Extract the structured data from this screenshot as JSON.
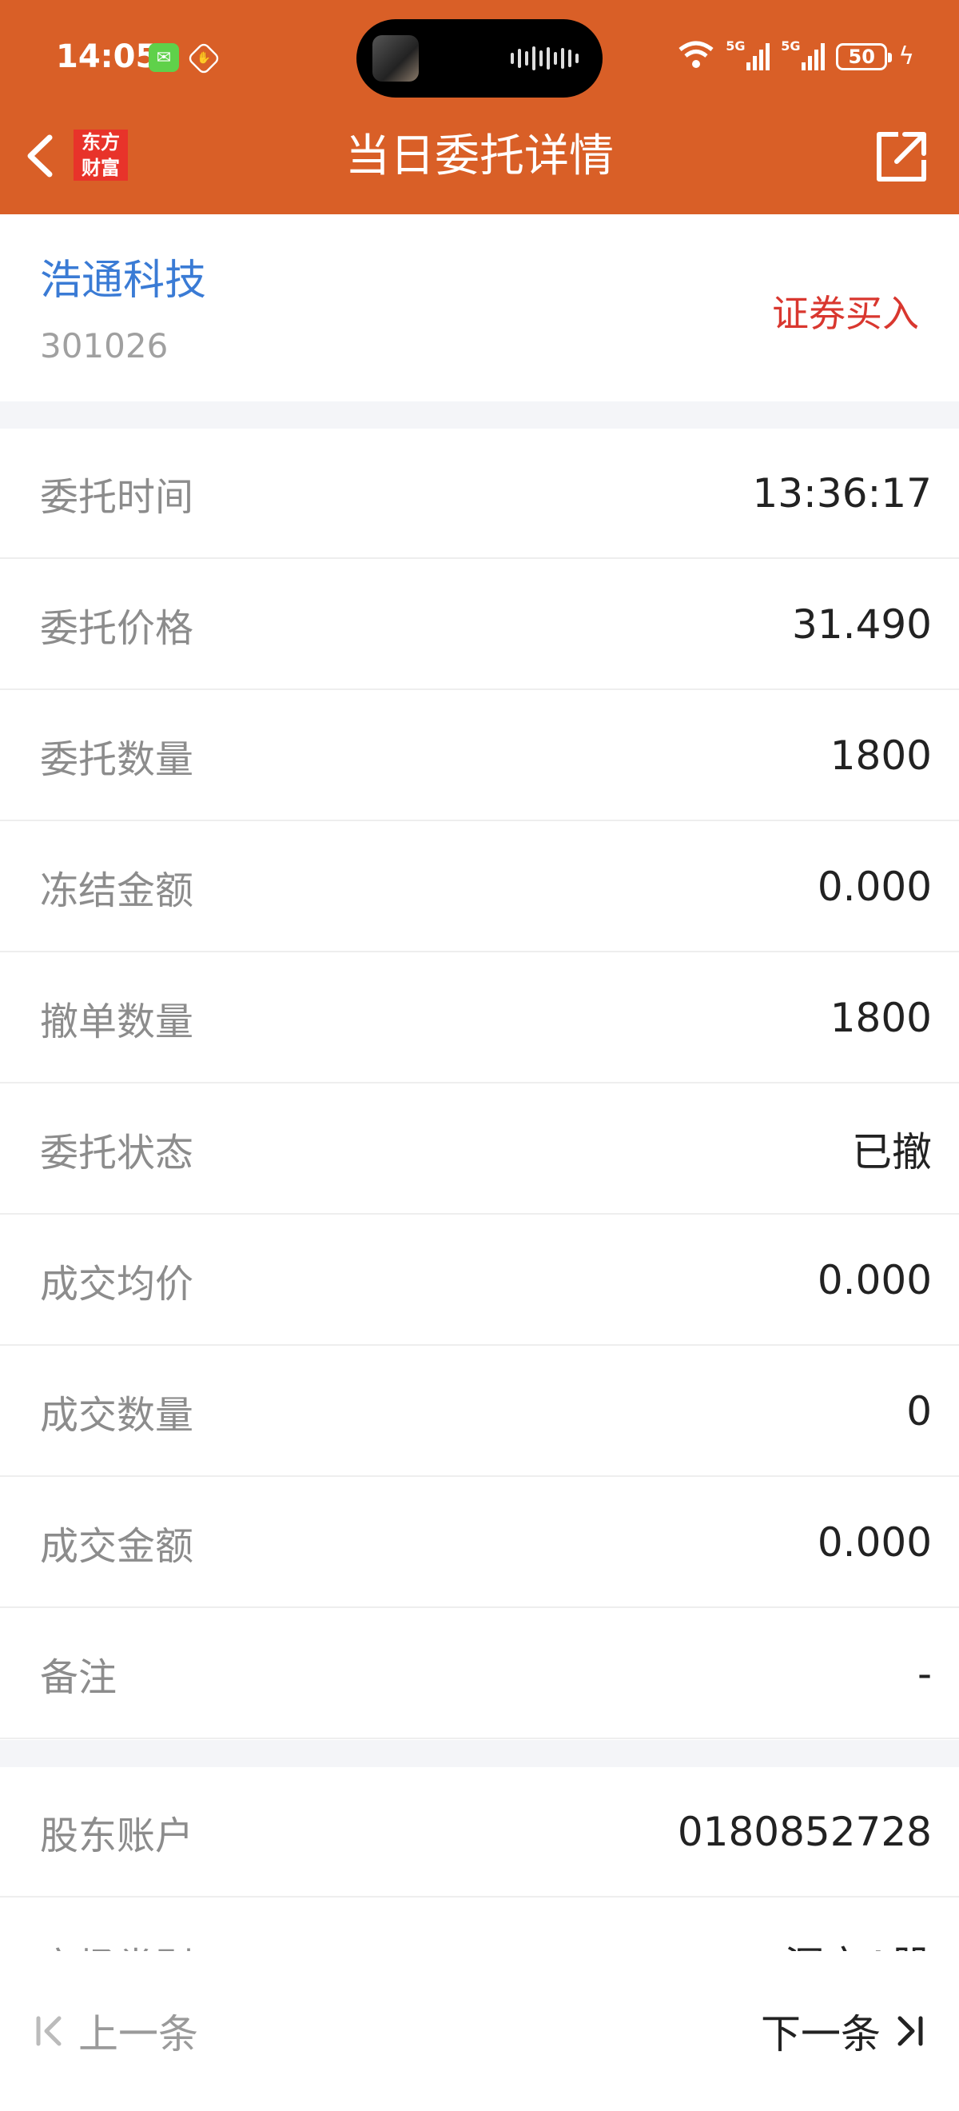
{
  "status_bar": {
    "time": "14:05",
    "battery": "50",
    "network_1": "5G",
    "network_2": "5G"
  },
  "header": {
    "brand_line1": "东方",
    "brand_line2": "财富",
    "title": "当日委托详情"
  },
  "stock": {
    "name": "浩通科技",
    "code": "301026",
    "trade_type": "证券买入"
  },
  "details": [
    {
      "label": "委托时间",
      "value": "13:36:17"
    },
    {
      "label": "委托价格",
      "value": "31.490"
    },
    {
      "label": "委托数量",
      "value": "1800"
    },
    {
      "label": "冻结金额",
      "value": "0.000"
    },
    {
      "label": "撤单数量",
      "value": "1800"
    },
    {
      "label": "委托状态",
      "value": "已撤"
    },
    {
      "label": "成交均价",
      "value": "0.000"
    },
    {
      "label": "成交数量",
      "value": "0"
    },
    {
      "label": "成交金额",
      "value": "0.000"
    },
    {
      "label": "备注",
      "value": "-"
    }
  ],
  "account": [
    {
      "label": "股东账户",
      "value": "0180852728"
    },
    {
      "label": "市场类别",
      "value": "深市A股"
    }
  ],
  "footer": {
    "prev_label": "上一条",
    "next_label": "下一条"
  },
  "colors": {
    "header_bg": "#d95f27",
    "stock_name": "#3a7bd5",
    "trade_type": "#d9372f"
  }
}
